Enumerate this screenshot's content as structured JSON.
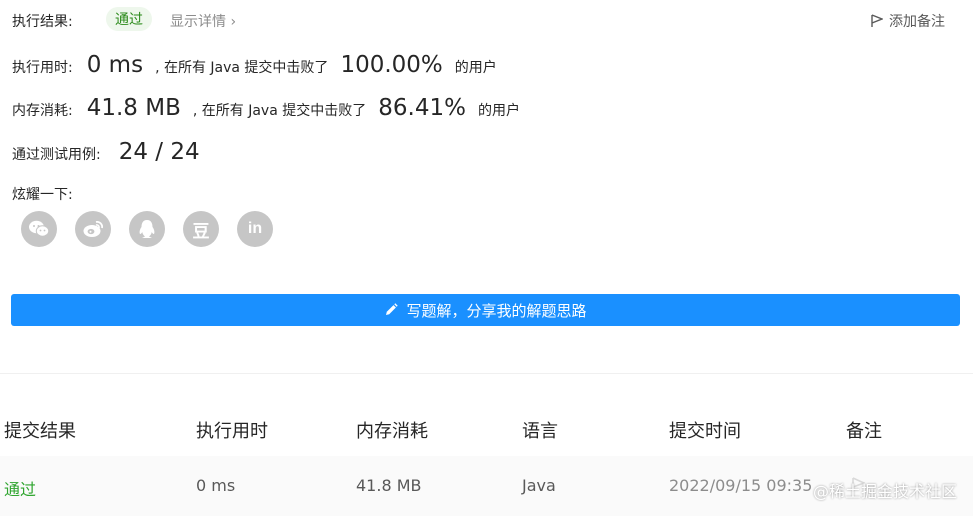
{
  "result": {
    "label": "执行结果:",
    "status": "通过",
    "detail_link": "显示详情 ›",
    "add_note": "添加备注"
  },
  "runtime": {
    "label": "执行用时:",
    "value": "0 ms",
    "mid": ", 在所有 Java 提交中击败了",
    "percent": "100.00%",
    "tail": "的用户"
  },
  "memory": {
    "label": "内存消耗:",
    "value": "41.8 MB",
    "mid": ", 在所有 Java 提交中击败了",
    "percent": "86.41%",
    "tail": "的用户"
  },
  "tests": {
    "label": "通过测试用例:",
    "value": "24 / 24"
  },
  "share": {
    "label": "炫耀一下:",
    "icons": [
      "wechat-icon",
      "weibo-icon",
      "qq-icon",
      "douban-icon",
      "linkedin-icon"
    ],
    "douban_glyph": "豆",
    "linkedin_glyph": "in"
  },
  "write_button": {
    "label": "写题解，分享我的解题思路"
  },
  "table": {
    "headers": [
      "提交结果",
      "执行用时",
      "内存消耗",
      "语言",
      "提交时间",
      "备注"
    ],
    "rows": [
      {
        "result": "通过",
        "runtime": "0 ms",
        "memory": "41.8 MB",
        "language": "Java",
        "time": "2022/09/15 09:35"
      }
    ]
  },
  "watermark": "@稀土掘金技术社区",
  "colors": {
    "accent": "#1a90ff",
    "pass": "#2fa52f",
    "icon_gray": "#c6c6c6"
  }
}
